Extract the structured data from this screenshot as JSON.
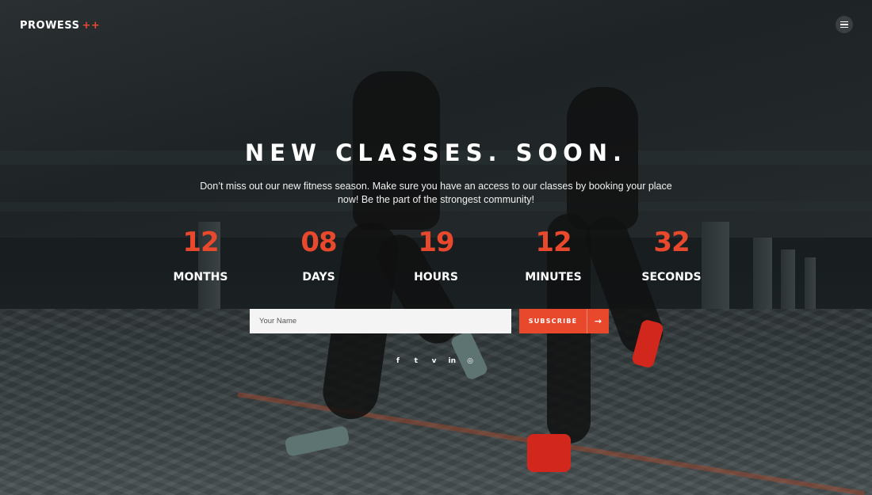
{
  "header": {
    "logo_text": "PROWESS",
    "logo_suffix": "++",
    "menu_icon": "hamburger-menu-icon"
  },
  "hero": {
    "title": "NEW CLASSES. SOON.",
    "subtitle": "Don’t miss out our new fitness season. Make sure you have an access to our classes by booking your place now! Be the part of the strongest community!"
  },
  "countdown": [
    {
      "value": "12",
      "label": "MONTHS"
    },
    {
      "value": "08",
      "label": "DAYS"
    },
    {
      "value": "19",
      "label": "HOURS"
    },
    {
      "value": "12",
      "label": "MINUTES"
    },
    {
      "value": "32",
      "label": "SECONDS"
    }
  ],
  "subscribe": {
    "placeholder": "Your Name",
    "button_label": "SUBSCRIBE",
    "arrow": "→"
  },
  "social": [
    {
      "name": "facebook",
      "glyph": "f"
    },
    {
      "name": "twitter",
      "glyph": "t"
    },
    {
      "name": "vimeo",
      "glyph": "v"
    },
    {
      "name": "linkedin",
      "glyph": "in"
    },
    {
      "name": "instagram",
      "glyph": "◎"
    }
  ],
  "colors": {
    "accent": "#e8492d",
    "text": "#ffffff",
    "input_bg": "#f4f4f4"
  }
}
